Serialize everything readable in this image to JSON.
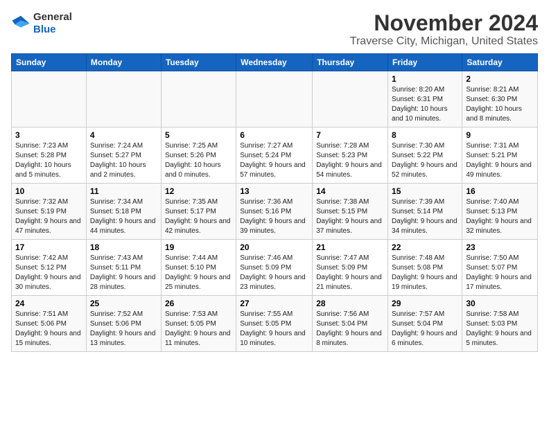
{
  "header": {
    "logo_line1": "General",
    "logo_line2": "Blue",
    "month": "November 2024",
    "location": "Traverse City, Michigan, United States"
  },
  "days_of_week": [
    "Sunday",
    "Monday",
    "Tuesday",
    "Wednesday",
    "Thursday",
    "Friday",
    "Saturday"
  ],
  "weeks": [
    [
      {
        "day": "",
        "info": ""
      },
      {
        "day": "",
        "info": ""
      },
      {
        "day": "",
        "info": ""
      },
      {
        "day": "",
        "info": ""
      },
      {
        "day": "",
        "info": ""
      },
      {
        "day": "1",
        "info": "Sunrise: 8:20 AM\nSunset: 6:31 PM\nDaylight: 10 hours and 10 minutes."
      },
      {
        "day": "2",
        "info": "Sunrise: 8:21 AM\nSunset: 6:30 PM\nDaylight: 10 hours and 8 minutes."
      }
    ],
    [
      {
        "day": "3",
        "info": "Sunrise: 7:23 AM\nSunset: 5:28 PM\nDaylight: 10 hours and 5 minutes."
      },
      {
        "day": "4",
        "info": "Sunrise: 7:24 AM\nSunset: 5:27 PM\nDaylight: 10 hours and 2 minutes."
      },
      {
        "day": "5",
        "info": "Sunrise: 7:25 AM\nSunset: 5:26 PM\nDaylight: 10 hours and 0 minutes."
      },
      {
        "day": "6",
        "info": "Sunrise: 7:27 AM\nSunset: 5:24 PM\nDaylight: 9 hours and 57 minutes."
      },
      {
        "day": "7",
        "info": "Sunrise: 7:28 AM\nSunset: 5:23 PM\nDaylight: 9 hours and 54 minutes."
      },
      {
        "day": "8",
        "info": "Sunrise: 7:30 AM\nSunset: 5:22 PM\nDaylight: 9 hours and 52 minutes."
      },
      {
        "day": "9",
        "info": "Sunrise: 7:31 AM\nSunset: 5:21 PM\nDaylight: 9 hours and 49 minutes."
      }
    ],
    [
      {
        "day": "10",
        "info": "Sunrise: 7:32 AM\nSunset: 5:19 PM\nDaylight: 9 hours and 47 minutes."
      },
      {
        "day": "11",
        "info": "Sunrise: 7:34 AM\nSunset: 5:18 PM\nDaylight: 9 hours and 44 minutes."
      },
      {
        "day": "12",
        "info": "Sunrise: 7:35 AM\nSunset: 5:17 PM\nDaylight: 9 hours and 42 minutes."
      },
      {
        "day": "13",
        "info": "Sunrise: 7:36 AM\nSunset: 5:16 PM\nDaylight: 9 hours and 39 minutes."
      },
      {
        "day": "14",
        "info": "Sunrise: 7:38 AM\nSunset: 5:15 PM\nDaylight: 9 hours and 37 minutes."
      },
      {
        "day": "15",
        "info": "Sunrise: 7:39 AM\nSunset: 5:14 PM\nDaylight: 9 hours and 34 minutes."
      },
      {
        "day": "16",
        "info": "Sunrise: 7:40 AM\nSunset: 5:13 PM\nDaylight: 9 hours and 32 minutes."
      }
    ],
    [
      {
        "day": "17",
        "info": "Sunrise: 7:42 AM\nSunset: 5:12 PM\nDaylight: 9 hours and 30 minutes."
      },
      {
        "day": "18",
        "info": "Sunrise: 7:43 AM\nSunset: 5:11 PM\nDaylight: 9 hours and 28 minutes."
      },
      {
        "day": "19",
        "info": "Sunrise: 7:44 AM\nSunset: 5:10 PM\nDaylight: 9 hours and 25 minutes."
      },
      {
        "day": "20",
        "info": "Sunrise: 7:46 AM\nSunset: 5:09 PM\nDaylight: 9 hours and 23 minutes."
      },
      {
        "day": "21",
        "info": "Sunrise: 7:47 AM\nSunset: 5:09 PM\nDaylight: 9 hours and 21 minutes."
      },
      {
        "day": "22",
        "info": "Sunrise: 7:48 AM\nSunset: 5:08 PM\nDaylight: 9 hours and 19 minutes."
      },
      {
        "day": "23",
        "info": "Sunrise: 7:50 AM\nSunset: 5:07 PM\nDaylight: 9 hours and 17 minutes."
      }
    ],
    [
      {
        "day": "24",
        "info": "Sunrise: 7:51 AM\nSunset: 5:06 PM\nDaylight: 9 hours and 15 minutes."
      },
      {
        "day": "25",
        "info": "Sunrise: 7:52 AM\nSunset: 5:06 PM\nDaylight: 9 hours and 13 minutes."
      },
      {
        "day": "26",
        "info": "Sunrise: 7:53 AM\nSunset: 5:05 PM\nDaylight: 9 hours and 11 minutes."
      },
      {
        "day": "27",
        "info": "Sunrise: 7:55 AM\nSunset: 5:05 PM\nDaylight: 9 hours and 10 minutes."
      },
      {
        "day": "28",
        "info": "Sunrise: 7:56 AM\nSunset: 5:04 PM\nDaylight: 9 hours and 8 minutes."
      },
      {
        "day": "29",
        "info": "Sunrise: 7:57 AM\nSunset: 5:04 PM\nDaylight: 9 hours and 6 minutes."
      },
      {
        "day": "30",
        "info": "Sunrise: 7:58 AM\nSunset: 5:03 PM\nDaylight: 9 hours and 5 minutes."
      }
    ]
  ]
}
